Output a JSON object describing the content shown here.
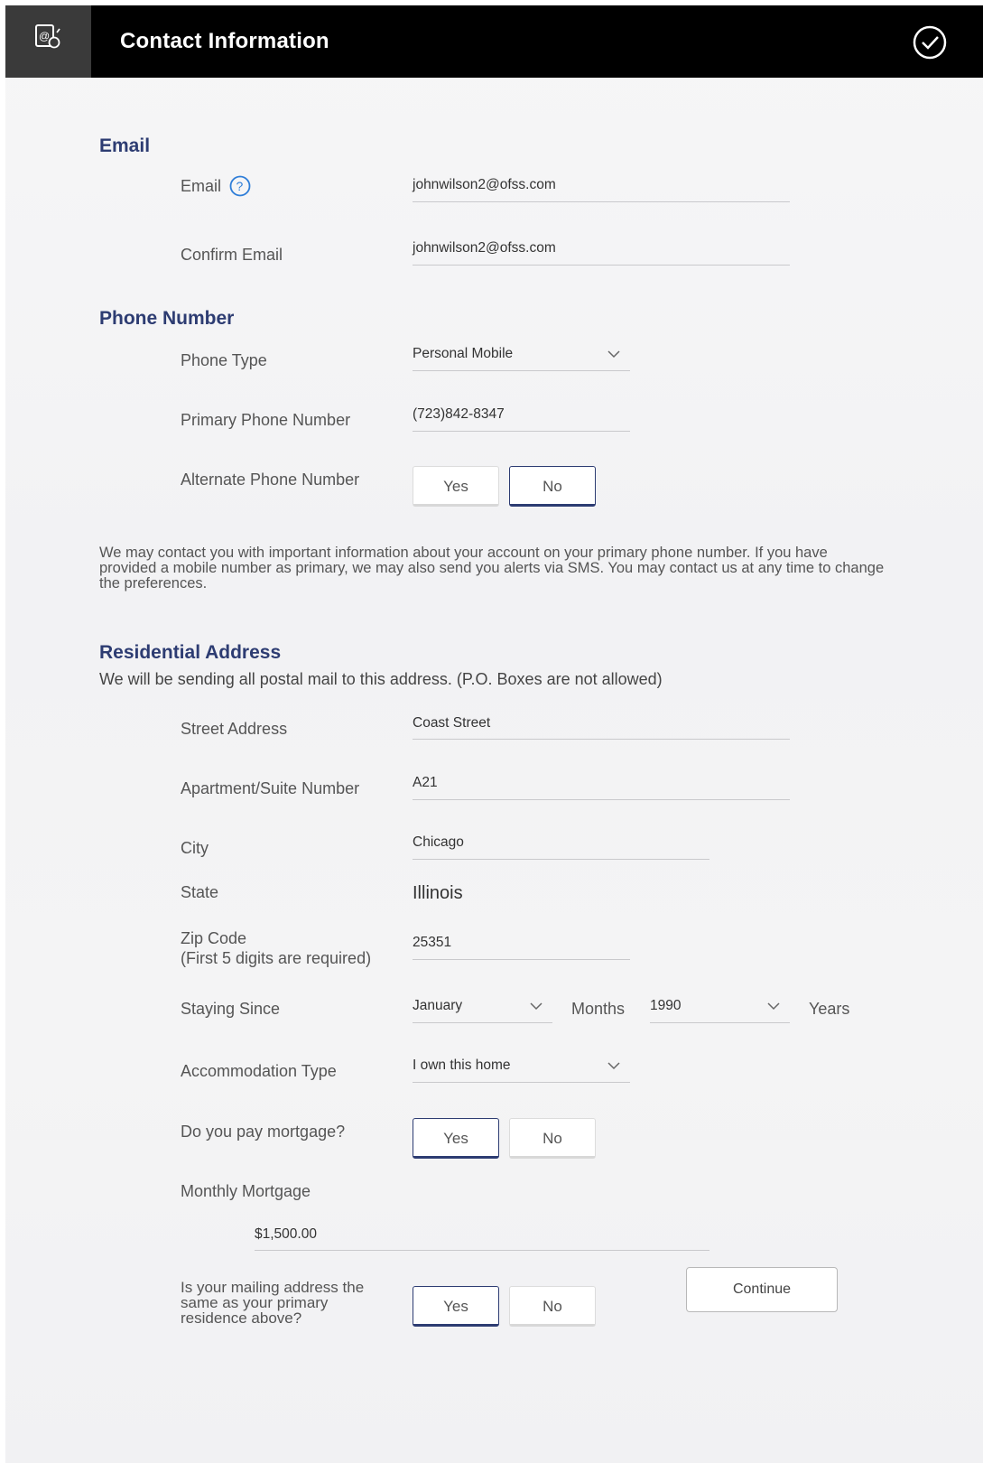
{
  "header": {
    "title": "Contact Information",
    "icon": "email-contact-icon",
    "done_icon": "check-circle-icon"
  },
  "email": {
    "section_title": "Email",
    "email_label": "Email",
    "email_value": "johnwilson2@ofss.com",
    "help_icon": "help-circle-icon",
    "confirm_label": "Confirm Email",
    "confirm_value": "johnwilson2@ofss.com"
  },
  "phone": {
    "section_title": "Phone Number",
    "type_label": "Phone Type",
    "type_value": "Personal Mobile",
    "primary_label": "Primary Phone Number",
    "primary_value": "(723)842-8347",
    "alternate_label": "Alternate Phone Number",
    "alternate_yes": "Yes",
    "alternate_no": "No",
    "alternate_selected": "No",
    "note": "We may contact you with important information about your account on your primary phone number. If you have provided a mobile number as primary, we may also send you alerts via SMS. You may contact us at any time to change the preferences."
  },
  "address": {
    "section_title": "Residential Address",
    "subtitle": "We will be sending all postal mail to this address. (P.O. Boxes are not allowed)",
    "street_label": "Street Address",
    "street_value": "Coast Street",
    "apt_label": "Apartment/Suite Number",
    "apt_value": "A21",
    "city_label": "City",
    "city_value": "Chicago",
    "state_label": "State",
    "state_value": "Illinois",
    "zip_label": "Zip Code",
    "zip_sublabel": "(First 5 digits are required)",
    "zip_value": "25351",
    "since_label": "Staying Since",
    "since_month": "January",
    "months_label": "Months",
    "since_year": "1990",
    "years_label": "Years",
    "accommodation_label": "Accommodation Type",
    "accommodation_value": "I own this home",
    "mortgage_label": "Do you pay mortgage?",
    "mortgage_yes": "Yes",
    "mortgage_no": "No",
    "mortgage_selected": "Yes",
    "monthly_label": "Monthly Mortgage",
    "monthly_value": "$1,500.00",
    "mailing_label_1": "Is your mailing address the",
    "mailing_label_2": "same as your primary",
    "mailing_label_3": "residence above?",
    "mailing_yes": "Yes",
    "mailing_no": "No",
    "mailing_selected": "Yes"
  },
  "actions": {
    "continue_label": "Continue"
  },
  "colors": {
    "accent": "#2d3c72",
    "header_bg": "#000000"
  }
}
